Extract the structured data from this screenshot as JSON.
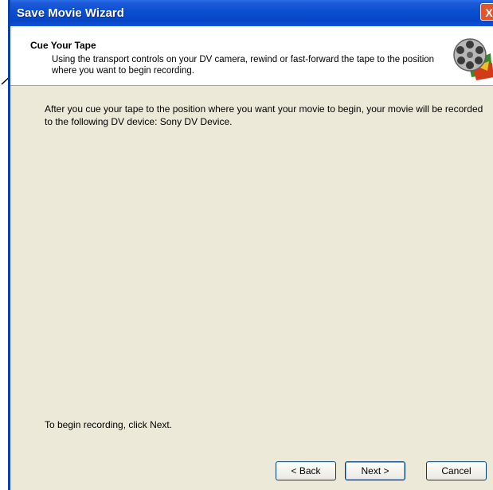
{
  "window": {
    "title": "Save Movie Wizard",
    "close_glyph": "X"
  },
  "header": {
    "title": "Cue Your Tape",
    "description": "Using the transport controls on your DV camera, rewind or fast-forward the tape to the position where you want to begin recording.",
    "icon": "film-reel-icon"
  },
  "main": {
    "body_text": "After you cue your tape to the position where you want your movie to begin, your movie will be recorded to the following DV device: Sony DV Device.",
    "footer_text": "To begin recording, click Next."
  },
  "buttons": {
    "back": "< Back",
    "next": "Next >",
    "cancel": "Cancel"
  },
  "colors": {
    "titlebar": "#0a4ed0",
    "dialog_bg": "#ece9d8",
    "close": "#e0552a"
  }
}
